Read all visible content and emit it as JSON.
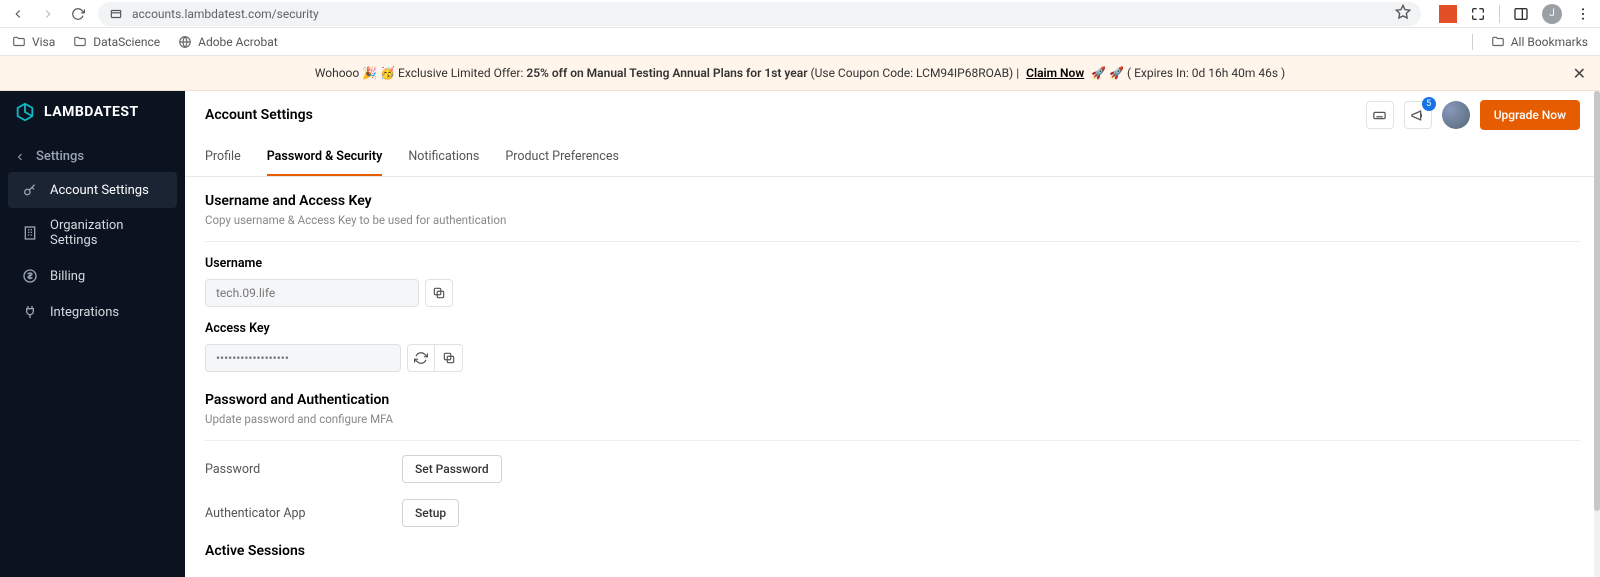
{
  "browser": {
    "url": "accounts.lambdatest.com/security",
    "profile_initial": "J",
    "bookmarks": [
      "Visa",
      "DataScience",
      "Adobe Acrobat"
    ],
    "all_bookmarks": "All Bookmarks"
  },
  "promo": {
    "prefix": "Wohooo 🎉 🥳  Exclusive Limited Offer:  ",
    "bold": "25% off on Manual Testing Annual Plans for 1st year ",
    "coupon": "(Use Coupon Code: LCM94IP68ROAB)  |  ",
    "claim": "Claim Now",
    "suffix": " 🚀 🚀   ( Expires In: 0d 16h 40m 46s )"
  },
  "sidebar": {
    "brand": "LAMBDATEST",
    "section": "Settings",
    "items": [
      {
        "label": "Account Settings"
      },
      {
        "label": "Organization Settings"
      },
      {
        "label": "Billing"
      },
      {
        "label": "Integrations"
      }
    ]
  },
  "header": {
    "title": "Account Settings",
    "notification_count": "5",
    "upgrade": "Upgrade Now"
  },
  "tabs": [
    "Profile",
    "Password & Security",
    "Notifications",
    "Product Preferences"
  ],
  "active_tab_index": 1,
  "sections": {
    "uak": {
      "title": "Username and Access Key",
      "sub": "Copy username & Access Key to be used for authentication",
      "username_label": "Username",
      "username_value": "tech.09.life",
      "accesskey_label": "Access Key",
      "accesskey_value": "••••••••••••••••••"
    },
    "auth": {
      "title": "Password and Authentication",
      "sub": "Update password and configure MFA",
      "rows": [
        {
          "label": "Password",
          "button": "Set Password"
        },
        {
          "label": "Authenticator App",
          "button": "Setup"
        }
      ]
    },
    "sessions": {
      "title": "Active Sessions"
    }
  }
}
